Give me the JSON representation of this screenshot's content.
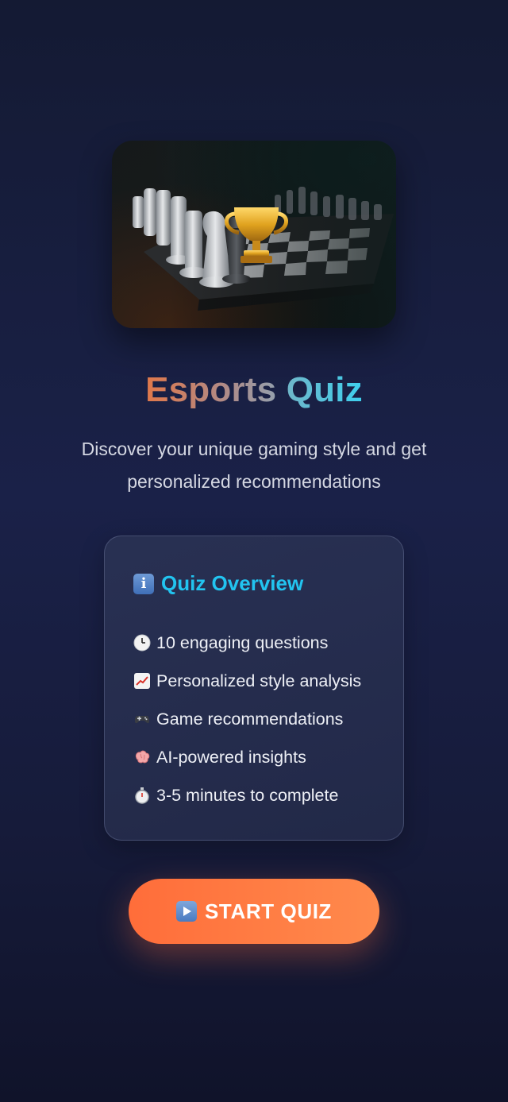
{
  "hero": {
    "image_name": "chess-board-with-trophy"
  },
  "header": {
    "title_part1": "Esports",
    "title_part2": "Quiz",
    "subtitle": "Discover your unique gaming style and get personalized recommendations"
  },
  "overview": {
    "icon": "info-icon",
    "title": "Quiz Overview",
    "items": [
      {
        "icon": "clock-icon",
        "label": "10 engaging questions"
      },
      {
        "icon": "chart-icon",
        "label": "Personalized style analysis"
      },
      {
        "icon": "gamepad-icon",
        "label": "Game recommendations"
      },
      {
        "icon": "brain-icon",
        "label": "AI-powered insights"
      },
      {
        "icon": "stopwatch-icon",
        "label": "3-5 minutes to complete"
      }
    ]
  },
  "cta": {
    "icon": "play-icon",
    "label": "START QUIZ"
  },
  "colors": {
    "accent_orange": "#ff7a42",
    "accent_cyan": "#22c4f0",
    "background": "#1a2148"
  }
}
